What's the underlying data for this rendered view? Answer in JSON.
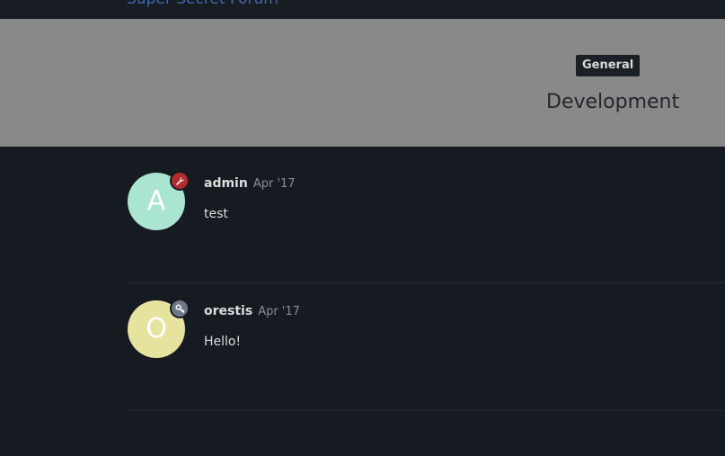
{
  "header": {
    "site_title": "Super Secret Forum"
  },
  "topic": {
    "category": "General",
    "title": "Development"
  },
  "posts": [
    {
      "username": "admin",
      "date": "Apr '17",
      "body": "test",
      "avatar_letter": "A",
      "avatar_color": "#aae5d1",
      "badge_icon": "wrench-icon",
      "badge_color": "#b32b2b"
    },
    {
      "username": "orestis",
      "date": "Apr '17",
      "body": "Hello!",
      "avatar_letter": "O",
      "avatar_color": "#e6e39f",
      "badge_icon": "key-icon",
      "badge_color": "#70788a"
    }
  ]
}
